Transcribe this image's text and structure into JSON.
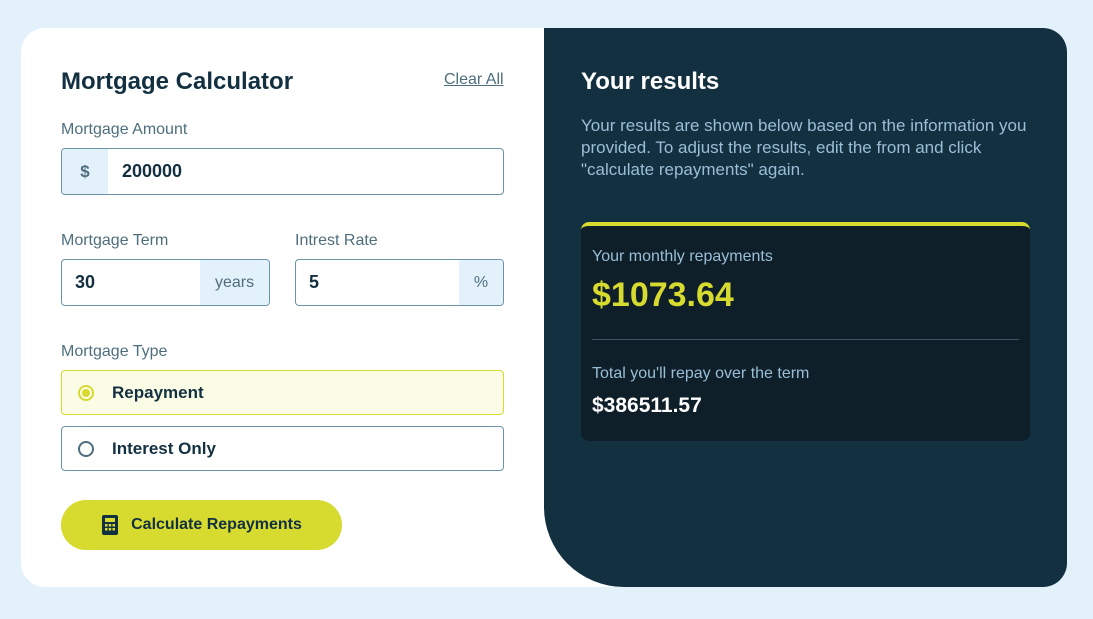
{
  "form": {
    "title": "Mortgage Calculator",
    "clear_label": "Clear All",
    "amount": {
      "label": "Mortgage Amount",
      "prefix": "$",
      "value": "200000"
    },
    "term": {
      "label": "Mortgage Term",
      "value": "30",
      "suffix": "years"
    },
    "rate": {
      "label": "Intrest Rate",
      "value": "5",
      "suffix": "%"
    },
    "type": {
      "label": "Mortgage Type",
      "options": [
        {
          "label": "Repayment",
          "selected": true
        },
        {
          "label": "Interest Only",
          "selected": false
        }
      ]
    },
    "submit_label": "Calculate Repayments"
  },
  "results": {
    "title": "Your results",
    "description": "Your results are shown below based on the information you provided. To adjust the results, edit the from and click \"calculate repayments\" again.",
    "monthly_label": "Your monthly repayments",
    "monthly_value": "$1073.64",
    "total_label": "Total you'll repay over the term",
    "total_value": "$386511.57"
  },
  "colors": {
    "accent": "#d7da2f",
    "dark": "#133041",
    "darker": "#0e1f2a",
    "muted": "#4e6e7e",
    "light_bg": "#e3f1fb"
  },
  "icons": {
    "submit": "calculator-icon"
  }
}
